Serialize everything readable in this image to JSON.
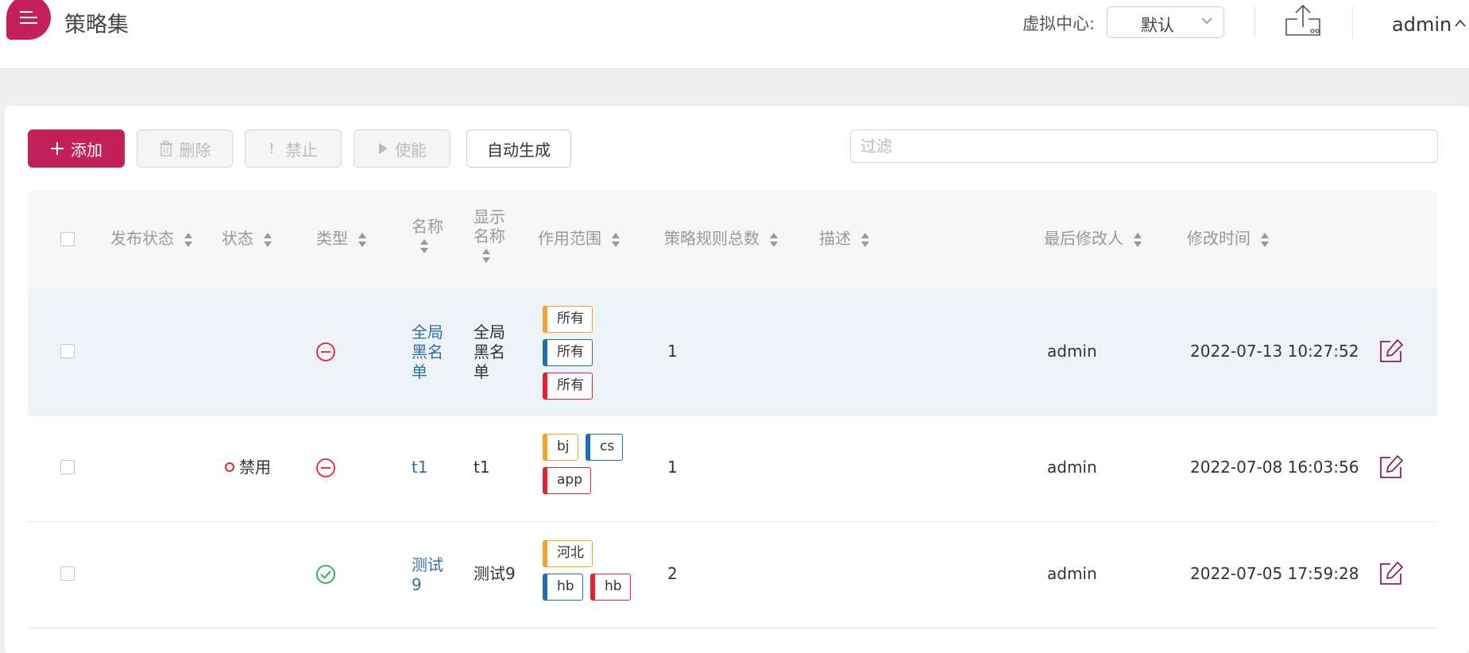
{
  "header": {
    "title": "策略集",
    "virtual_center_label": "虚拟中心:",
    "virtual_center_value": "默认",
    "user": "admin"
  },
  "toolbar": {
    "add_label": "添加",
    "delete_label": "删除",
    "disable_label": "禁止",
    "enable_label": "使能",
    "autogen_label": "自动生成",
    "filter_placeholder": "过滤"
  },
  "table": {
    "headers": {
      "publish_status": "发布状态",
      "status": "状态",
      "type": "类型",
      "name_line1": "名称",
      "display_name_line1": "显示",
      "display_name_line2": "名称",
      "scope": "作用范围",
      "rule_count": "策略规则总数",
      "description": "描述",
      "last_modifier": "最后修改人",
      "modified_time": "修改时间"
    },
    "rows": [
      {
        "status": "",
        "type_icon": "block-icon",
        "name_lines": [
          "全局",
          "黑名",
          "单"
        ],
        "display_lines": [
          "全局",
          "黑名",
          "单"
        ],
        "scope": [
          "所有",
          "所有",
          "所有"
        ],
        "rule_count": "1",
        "description": "",
        "last_modifier": "admin",
        "modified_time": "2022-07-13 10:27:52"
      },
      {
        "status": "禁用",
        "type_icon": "block-icon",
        "name_lines": [
          "t1"
        ],
        "display_lines": [
          "t1"
        ],
        "scope": [
          "bj",
          "cs",
          "app"
        ],
        "rule_count": "1",
        "description": "",
        "last_modifier": "admin",
        "modified_time": "2022-07-08 16:03:56"
      },
      {
        "status": "",
        "type_icon": "check-circle-icon",
        "name_lines": [
          "测试",
          "9"
        ],
        "display_lines": [
          "测试9"
        ],
        "scope": [
          "河北",
          "hb",
          "hb"
        ],
        "rule_count": "2",
        "description": "",
        "last_modifier": "admin",
        "modified_time": "2022-07-05 17:59:28"
      }
    ]
  },
  "colors": {
    "brand": "#c4215a",
    "tag_orange": "#f0a52a",
    "tag_blue": "#1f6fb0",
    "tag_red": "#e8202f",
    "link": "#2f6fa7",
    "allow_green": "#2ea84a"
  }
}
